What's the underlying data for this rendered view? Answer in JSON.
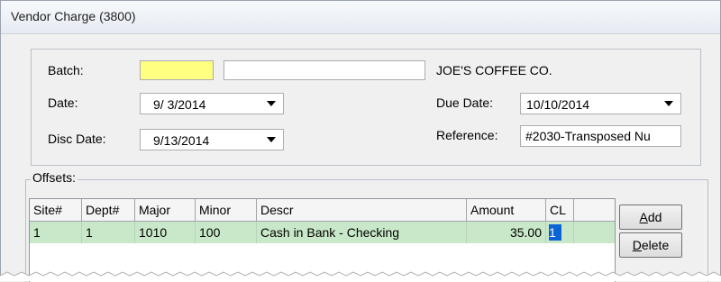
{
  "window": {
    "title": "Vendor Charge (3800)"
  },
  "form": {
    "batch_label": "Batch:",
    "batch_code": "",
    "batch_name": "",
    "vendor_name": "JOE'S COFFEE CO.",
    "date_label": "Date:",
    "date_value": "9/ 3/2014",
    "due_date_label": "Due Date:",
    "due_date_value": "10/10/2014",
    "disc_date_label": "Disc Date:",
    "disc_date_value": "9/13/2014",
    "reference_label": "Reference:",
    "reference_value": "#2030-Transposed Nu"
  },
  "offsets": {
    "label": "Offsets:",
    "columns": [
      "Site#",
      "Dept#",
      "Major",
      "Minor",
      "Descr",
      "Amount",
      "CL"
    ],
    "rows": [
      {
        "site": "1",
        "dept": "1",
        "major": "1010",
        "minor": "100",
        "descr": "Cash in Bank - Checking",
        "amount": "35.00",
        "cl": "1"
      }
    ],
    "buttons": {
      "add_mnemonic": "A",
      "add_rest": "dd",
      "delete_mnemonic": "D",
      "delete_rest": "elete"
    }
  },
  "icons": {
    "dropdown": "chevron-down-icon"
  },
  "colors": {
    "batch_field": "#ffff80",
    "row_highlight": "#c9e8c9",
    "cell_selection": "#0a64d4"
  }
}
